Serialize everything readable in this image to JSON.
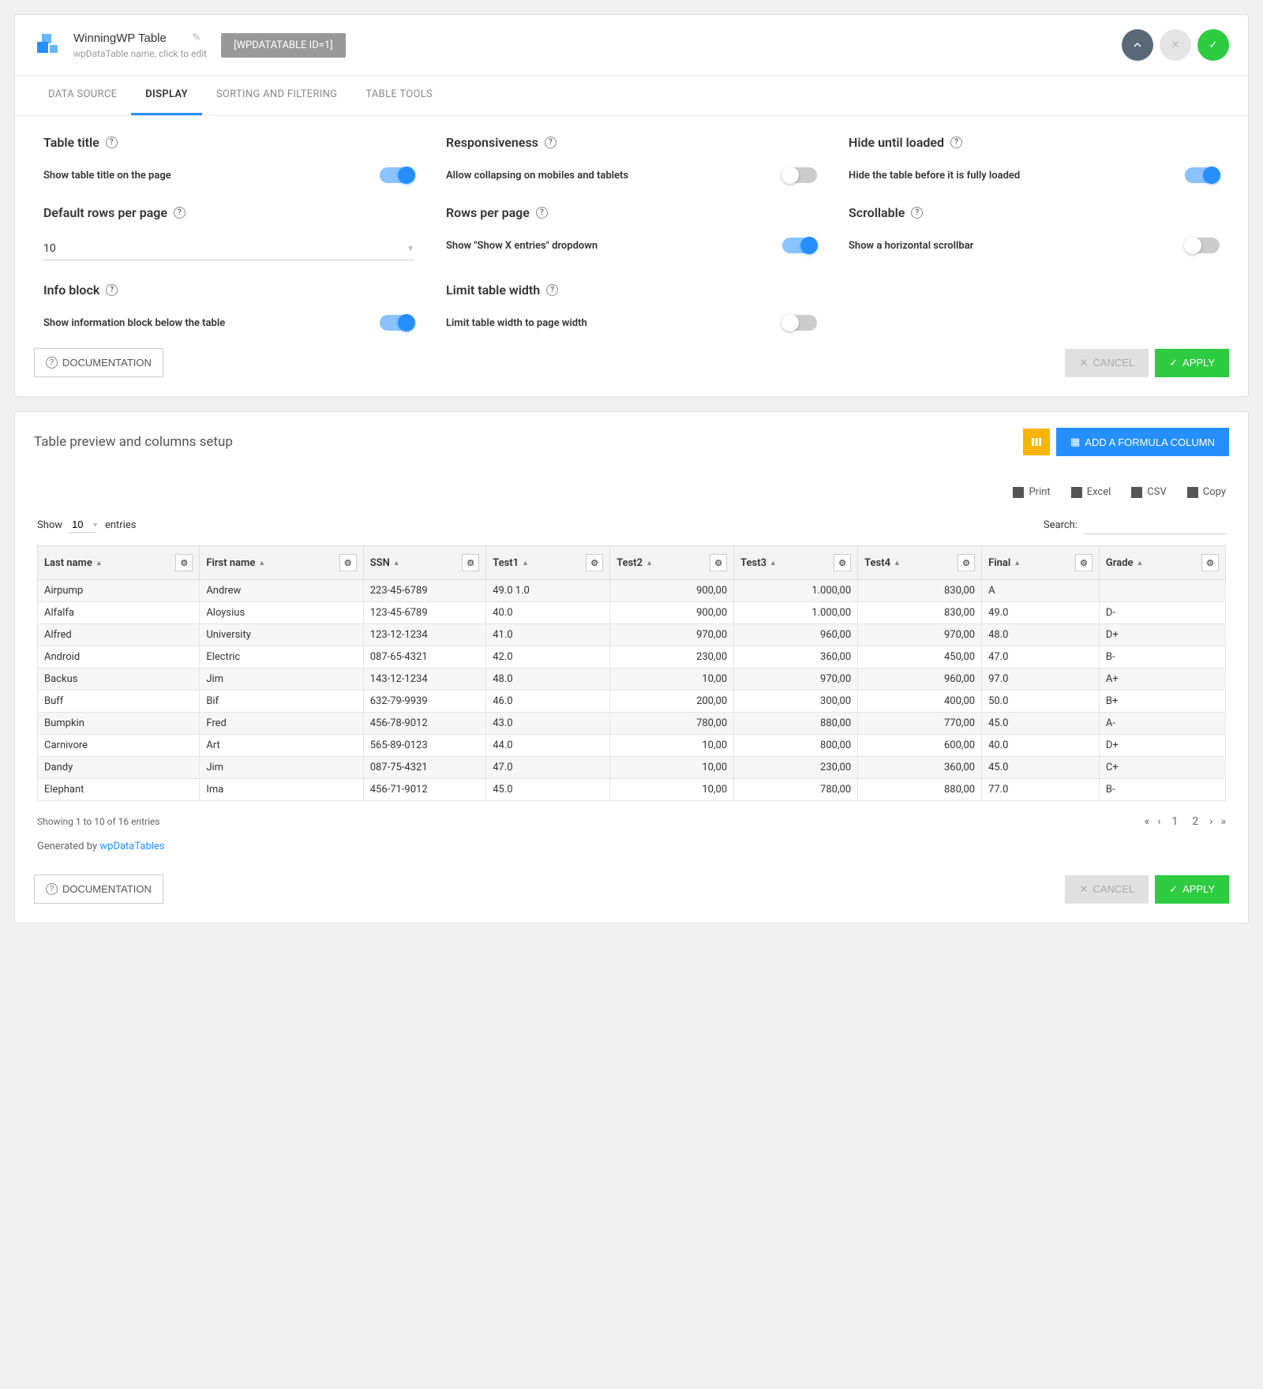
{
  "header": {
    "title": "WinningWP Table",
    "subtitle": "wpDataTable name, click to edit",
    "shortcode": "[WPDATATABLE ID=1]"
  },
  "tabs": [
    "DATA SOURCE",
    "DISPLAY",
    "SORTING AND FILTERING",
    "TABLE TOOLS"
  ],
  "settings": {
    "tableTitle": {
      "title": "Table title",
      "desc": "Show table title on the page"
    },
    "responsiveness": {
      "title": "Responsiveness",
      "desc": "Allow collapsing on mobiles and tablets"
    },
    "hideLoaded": {
      "title": "Hide until loaded",
      "desc": "Hide the table before it is fully loaded"
    },
    "defaultRows": {
      "title": "Default rows per page",
      "value": "10"
    },
    "rowsPerPage": {
      "title": "Rows per page",
      "desc": "Show \"Show X entries\" dropdown"
    },
    "scrollable": {
      "title": "Scrollable",
      "desc": "Show a horizontal scrollbar"
    },
    "infoBlock": {
      "title": "Info block",
      "desc": "Show information block below the table"
    },
    "limitWidth": {
      "title": "Limit table width",
      "desc": "Limit table width to page width"
    }
  },
  "buttons": {
    "documentation": "DOCUMENTATION",
    "cancel": "CANCEL",
    "apply": "APPLY",
    "addFormula": "ADD A FORMULA COLUMN"
  },
  "preview": {
    "title": "Table preview and columns setup"
  },
  "exports": {
    "print": "Print",
    "excel": "Excel",
    "csv": "CSV",
    "copy": "Copy"
  },
  "entries": {
    "show": "Show",
    "entries": "entries",
    "value": "10"
  },
  "search": {
    "label": "Search:"
  },
  "columns": [
    "Last name",
    "First name",
    "SSN",
    "Test1",
    "Test2",
    "Test3",
    "Test4",
    "Final",
    "Grade"
  ],
  "rows": [
    {
      "ln": "Airpump",
      "fn": "Andrew",
      "ssn": "223-45-6789",
      "t1": "49.0 1.0",
      "t2": "900,00",
      "t3": "1.000,00",
      "t4": "830,00",
      "fin": "A",
      "gr": ""
    },
    {
      "ln": "Alfalfa",
      "fn": "Aloysius",
      "ssn": "123-45-6789",
      "t1": "40.0",
      "t2": "900,00",
      "t3": "1.000,00",
      "t4": "830,00",
      "fin": "49.0",
      "gr": "D-"
    },
    {
      "ln": "Alfred",
      "fn": "University",
      "ssn": "123-12-1234",
      "t1": "41.0",
      "t2": "970,00",
      "t3": "960,00",
      "t4": "970,00",
      "fin": "48.0",
      "gr": "D+"
    },
    {
      "ln": "Android",
      "fn": "Electric",
      "ssn": "087-65-4321",
      "t1": "42.0",
      "t2": "230,00",
      "t3": "360,00",
      "t4": "450,00",
      "fin": "47.0",
      "gr": "B-"
    },
    {
      "ln": "Backus",
      "fn": "Jim",
      "ssn": "143-12-1234",
      "t1": "48.0",
      "t2": "10,00",
      "t3": "970,00",
      "t4": "960,00",
      "fin": "97.0",
      "gr": "A+"
    },
    {
      "ln": "Buff",
      "fn": "Bif",
      "ssn": "632-79-9939",
      "t1": "46.0",
      "t2": "200,00",
      "t3": "300,00",
      "t4": "400,00",
      "fin": "50.0",
      "gr": "B+"
    },
    {
      "ln": "Bumpkin",
      "fn": "Fred",
      "ssn": "456-78-9012",
      "t1": "43.0",
      "t2": "780,00",
      "t3": "880,00",
      "t4": "770,00",
      "fin": "45.0",
      "gr": "A-"
    },
    {
      "ln": "Carnivore",
      "fn": "Art",
      "ssn": "565-89-0123",
      "t1": "44.0",
      "t2": "10,00",
      "t3": "800,00",
      "t4": "600,00",
      "fin": "40.0",
      "gr": "D+"
    },
    {
      "ln": "Dandy",
      "fn": "Jim",
      "ssn": "087-75-4321",
      "t1": "47.0",
      "t2": "10,00",
      "t3": "230,00",
      "t4": "360,00",
      "fin": "45.0",
      "gr": "C+"
    },
    {
      "ln": "Elephant",
      "fn": "Ima",
      "ssn": "456-71-9012",
      "t1": "45.0",
      "t2": "10,00",
      "t3": "780,00",
      "t4": "880,00",
      "fin": "77.0",
      "gr": "B-"
    }
  ],
  "info": "Showing 1 to 10 of 16 entries",
  "generated": {
    "prefix": "Generated by ",
    "link": "wpDataTables"
  }
}
